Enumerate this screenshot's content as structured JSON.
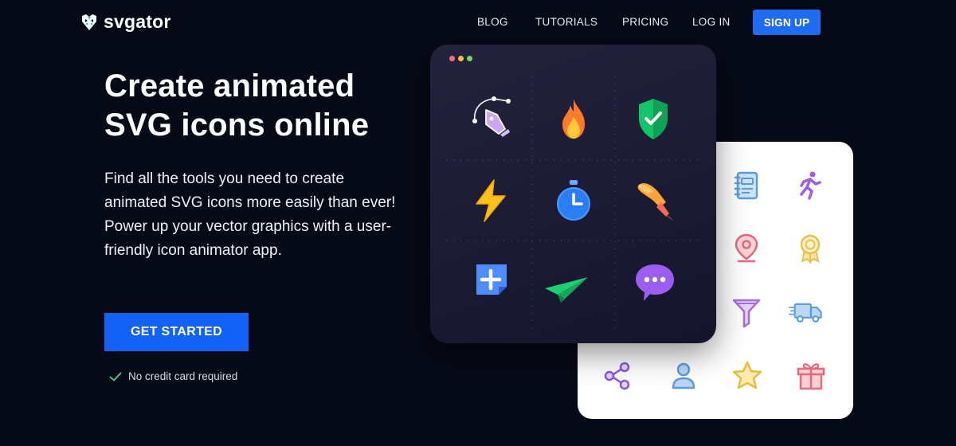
{
  "brand": {
    "name": "svgator",
    "logo_icon": "alligator-logo-icon"
  },
  "nav": {
    "blog": "BLOG",
    "tutorials": "TUTORIALS",
    "pricing": "PRICING",
    "login": "LOG IN",
    "signup": "SIGN UP"
  },
  "hero": {
    "title_line1": "Create animated",
    "title_line2": "SVG icons online",
    "description": "Find all the tools you need to create animated SVG icons more easily than ever! Power up your vector graphics with a user-friendly icon animator app.",
    "cta": "GET STARTED",
    "note": "No credit card required"
  },
  "dark_panel": {
    "window_dots": [
      "#ff6b8b",
      "#ffbe3d",
      "#7ad36b"
    ],
    "icons": [
      "pen-tool-icon",
      "flame-icon",
      "shield-check-icon",
      "lightning-icon",
      "stopwatch-icon",
      "paintbrush-icon",
      "add-note-icon",
      "paper-plane-icon",
      "chat-bubble-icon"
    ]
  },
  "white_panel": {
    "icons": [
      "notebook-icon",
      "running-person-icon",
      "location-pin-icon",
      "award-medal-icon",
      "filter-icon",
      "delivery-truck-icon",
      "share-icon",
      "user-icon",
      "star-icon",
      "gift-icon"
    ]
  },
  "colors": {
    "background": "#060a17",
    "accent": "#1462f5"
  }
}
